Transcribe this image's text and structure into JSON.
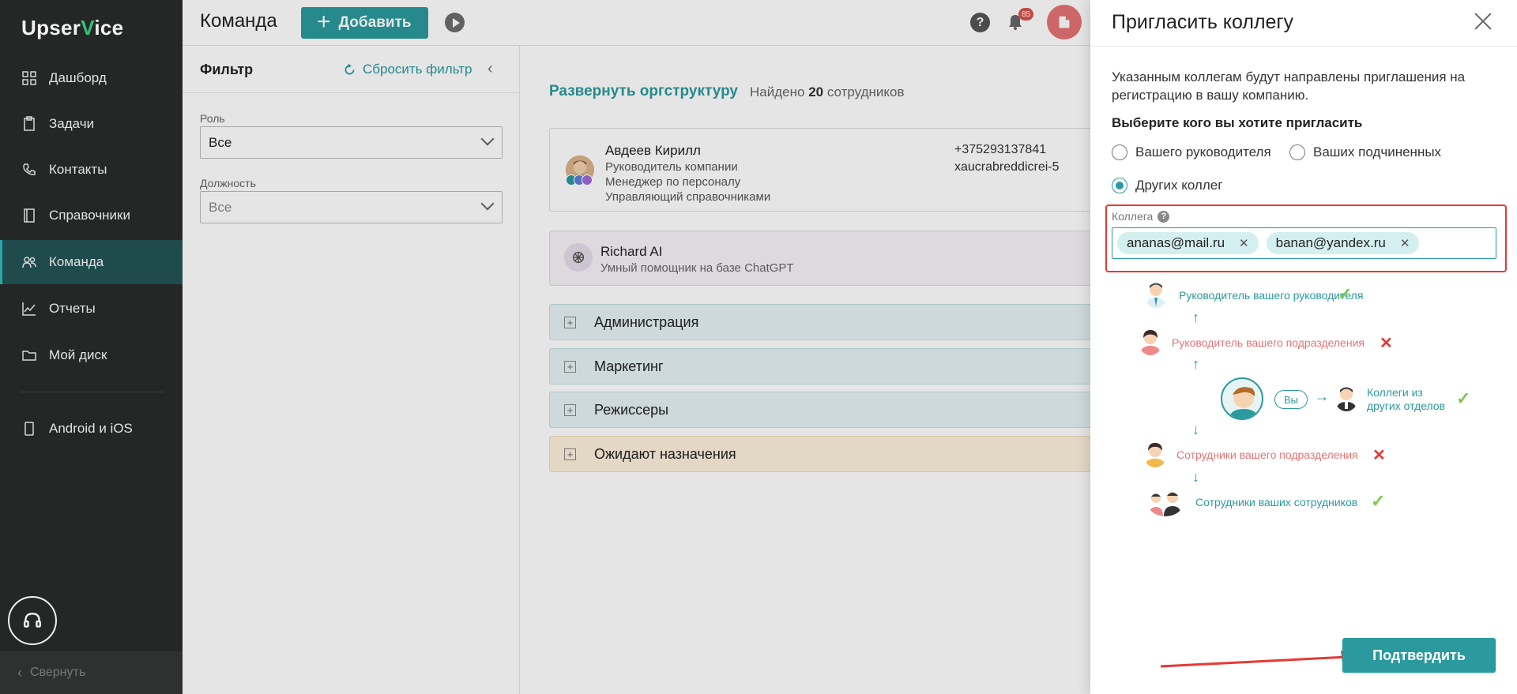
{
  "app": {
    "logo_prefix": "Upser",
    "logo_v": "V",
    "logo_suffix": "ice"
  },
  "sidebar": {
    "items": [
      {
        "label": "Дашборд",
        "icon": "dashboard-icon"
      },
      {
        "label": "Задачи",
        "icon": "tasks-icon"
      },
      {
        "label": "Контакты",
        "icon": "contacts-icon"
      },
      {
        "label": "Справочники",
        "icon": "book-icon"
      },
      {
        "label": "Команда",
        "icon": "team-icon",
        "active": true
      },
      {
        "label": "Отчеты",
        "icon": "chart-icon"
      },
      {
        "label": "Мой диск",
        "icon": "folder-icon"
      },
      {
        "label": "Android и iOS",
        "icon": "phone-icon"
      }
    ],
    "collapse_label": "Свернуть"
  },
  "header": {
    "title": "Команда",
    "add_label": "Добавить",
    "notifications_count": "85"
  },
  "filter": {
    "title": "Фильтр",
    "reset_label": "Сбросить фильтр",
    "role_label": "Роль",
    "role_value": "Все",
    "position_label": "Должность",
    "position_value": "Все"
  },
  "content": {
    "org_link": "Развернуть оргструктуру",
    "found_prefix": "Найдено",
    "found_count": "20",
    "found_suffix": "сотрудников",
    "employee": {
      "name": "Авдеев Кирилл",
      "roles": [
        "Руководитель компании",
        "Менеджер по персоналу",
        "Управляющий справочниками"
      ],
      "phone": "+375293137841",
      "email": "xaucrabreddicrei-5"
    },
    "ai": {
      "name": "Richard AI",
      "subtitle": "Умный помощник на базе ChatGPT"
    },
    "departments": [
      "Администрация",
      "Маркетинг",
      "Режиссеры",
      "Ожидают назначения"
    ]
  },
  "invite": {
    "title": "Пригласить коллегу",
    "description": "Указанным коллегам будут направлены приглашения на регистрацию в вашу компанию.",
    "choose_label": "Выберите кого вы хотите пригласить",
    "options": [
      {
        "label": "Вашего руководителя",
        "checked": false
      },
      {
        "label": "Ваших подчиненных",
        "checked": false
      },
      {
        "label": "Других коллег",
        "checked": true
      }
    ],
    "colleague_label": "Коллега",
    "tags": [
      "ananas@mail.ru",
      "banan@yandex.ru"
    ],
    "diagram": {
      "boss_of_boss": "Руководитель вашего руководителя",
      "dept_head": "Руководитель вашего подразделения",
      "you": "Вы",
      "other_depts_line1": "Коллеги из",
      "other_depts_line2": "других отделов",
      "dept_staff": "Сотрудники вашего подразделения",
      "staff_of_staff": "Сотрудники ваших сотрудников"
    },
    "confirm_label": "Подтвердить"
  },
  "colors": {
    "accent": "#2b9a9e",
    "sidebar": "#252727",
    "error": "#e53935",
    "ok": "#7bc84d"
  }
}
